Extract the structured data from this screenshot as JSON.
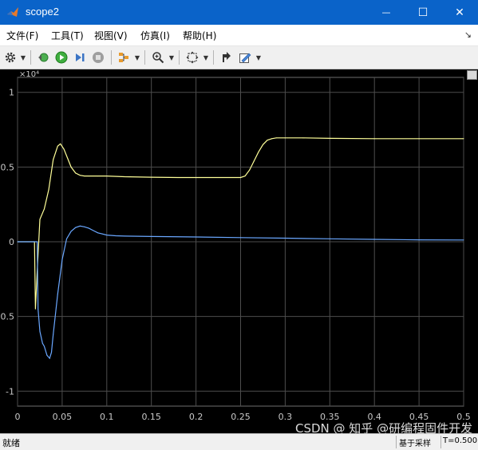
{
  "window": {
    "title": "scope2",
    "minimize_glyph": "—",
    "maximize_glyph": "☐",
    "close_glyph": "✕"
  },
  "menu": {
    "items": [
      "文件(F)",
      "工具(T)",
      "视图(V)",
      "仿真(I)",
      "帮助(H)"
    ],
    "pin_glyph": "↘"
  },
  "toolbar": {
    "icons": [
      "gear-icon",
      "restore-icon",
      "run-icon",
      "step-forward-icon",
      "stop-icon",
      "highlight-icon",
      "zoom-icon",
      "autoscale-icon",
      "cursor-measure-icon",
      "style-icon"
    ]
  },
  "colors": {
    "titlebar": "#0a63c9",
    "plot_background": "#000000",
    "grid": "#4d4d4d",
    "axis_text": "#c8c8c8",
    "series_yellow": "#ffff99",
    "series_blue": "#6aa7ff"
  },
  "chart_data": {
    "type": "line",
    "exponent_label": "×10⁴",
    "xlim": [
      0,
      0.5
    ],
    "ylim": [
      -1.1,
      1.1
    ],
    "grid": true,
    "x_ticks": [
      "0",
      "0.05",
      "0.1",
      "0.15",
      "0.2",
      "0.25",
      "0.3",
      "0.35",
      "0.4",
      "0.45",
      "0.5"
    ],
    "y_ticks": [
      "1",
      "0.5",
      "0",
      "-0.5",
      "-1"
    ],
    "series": [
      {
        "color": "#ffff99",
        "x": [
          0,
          0.019,
          0.02,
          0.022,
          0.025,
          0.03,
          0.035,
          0.04,
          0.045,
          0.048,
          0.052,
          0.056,
          0.06,
          0.065,
          0.07,
          0.075,
          0.08,
          0.09,
          0.1,
          0.12,
          0.15,
          0.18,
          0.2,
          0.22,
          0.24,
          0.25,
          0.255,
          0.26,
          0.265,
          0.27,
          0.275,
          0.28,
          0.285,
          0.29,
          0.3,
          0.32,
          0.35,
          0.4,
          0.45,
          0.5
        ],
        "y": [
          0,
          0,
          -0.45,
          -0.2,
          0.15,
          0.22,
          0.35,
          0.55,
          0.64,
          0.655,
          0.62,
          0.56,
          0.5,
          0.46,
          0.445,
          0.44,
          0.44,
          0.44,
          0.44,
          0.435,
          0.432,
          0.43,
          0.43,
          0.43,
          0.43,
          0.43,
          0.44,
          0.48,
          0.54,
          0.6,
          0.65,
          0.68,
          0.69,
          0.695,
          0.695,
          0.695,
          0.692,
          0.69,
          0.69,
          0.69
        ]
      },
      {
        "color": "#6aa7ff",
        "x": [
          0,
          0.022,
          0.023,
          0.025,
          0.028,
          0.03,
          0.033,
          0.036,
          0.038,
          0.04,
          0.045,
          0.05,
          0.055,
          0.06,
          0.065,
          0.07,
          0.075,
          0.08,
          0.085,
          0.09,
          0.1,
          0.11,
          0.12,
          0.15,
          0.2,
          0.25,
          0.3,
          0.35,
          0.4,
          0.45,
          0.5
        ],
        "y": [
          0,
          0,
          -0.45,
          -0.6,
          -0.68,
          -0.7,
          -0.76,
          -0.78,
          -0.74,
          -0.62,
          -0.35,
          -0.12,
          0.02,
          0.07,
          0.095,
          0.105,
          0.1,
          0.09,
          0.075,
          0.06,
          0.045,
          0.04,
          0.038,
          0.035,
          0.032,
          0.028,
          0.024,
          0.02,
          0.016,
          0.013,
          0.012
        ]
      }
    ]
  },
  "status": {
    "left": "就绪",
    "mid": "基于采样",
    "right": "T=0.500"
  },
  "watermark": "CSDN @ 知乎 @研编程固件开发"
}
